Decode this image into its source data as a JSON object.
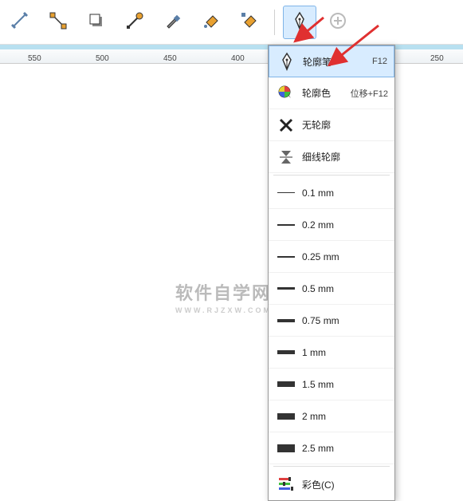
{
  "toolbar": {
    "tools": [
      {
        "name": "dimension-tool",
        "icon": "dimension"
      },
      {
        "name": "connector-tool",
        "icon": "connector"
      },
      {
        "name": "shadow-tool",
        "icon": "shadow"
      },
      {
        "name": "transparency-tool",
        "icon": "transparency"
      },
      {
        "name": "eyedropper-tool",
        "icon": "eyedropper"
      },
      {
        "name": "fill-tool",
        "icon": "fill"
      },
      {
        "name": "interactive-fill-tool",
        "icon": "interactive-fill"
      },
      {
        "name": "outline-pen-tool",
        "icon": "pen-nib",
        "active": true
      },
      {
        "name": "add-tool",
        "icon": "plus"
      }
    ]
  },
  "ruler": {
    "ticks": [
      {
        "pos": 35,
        "label": "550"
      },
      {
        "pos": 120,
        "label": "500"
      },
      {
        "pos": 205,
        "label": "450"
      },
      {
        "pos": 290,
        "label": "400"
      },
      {
        "pos": 540,
        "label": "250"
      }
    ]
  },
  "watermark": {
    "main": "软件自学网",
    "sub": "WWW.RJZXW.COM"
  },
  "flyout": {
    "items": [
      {
        "type": "cmd",
        "icon": "pen-nib",
        "label": "轮廓笔",
        "shortcut": "F12",
        "highlighted": true,
        "name": "outline-pen"
      },
      {
        "type": "cmd",
        "icon": "color-wheel",
        "label": "轮廓色",
        "shortcut": "位移+F12",
        "name": "outline-color"
      },
      {
        "type": "cmd",
        "icon": "x-mark",
        "label": "无轮廓",
        "name": "no-outline"
      },
      {
        "type": "cmd",
        "icon": "hairline",
        "label": "细线轮廓",
        "name": "hairline-outline"
      },
      {
        "type": "sep"
      },
      {
        "type": "thickness",
        "label": "0.1 mm",
        "h": 1,
        "name": "thickness-0-1"
      },
      {
        "type": "thickness",
        "label": "0.2 mm",
        "h": 2,
        "name": "thickness-0-2"
      },
      {
        "type": "thickness",
        "label": "0.25 mm",
        "h": 2,
        "name": "thickness-0-25"
      },
      {
        "type": "thickness",
        "label": "0.5 mm",
        "h": 3,
        "name": "thickness-0-5"
      },
      {
        "type": "thickness",
        "label": "0.75 mm",
        "h": 4,
        "name": "thickness-0-75"
      },
      {
        "type": "thickness",
        "label": "1 mm",
        "h": 5,
        "name": "thickness-1"
      },
      {
        "type": "thickness",
        "label": "1.5 mm",
        "h": 7,
        "name": "thickness-1-5"
      },
      {
        "type": "thickness",
        "label": "2 mm",
        "h": 8,
        "name": "thickness-2"
      },
      {
        "type": "thickness",
        "label": "2.5 mm",
        "h": 10,
        "name": "thickness-2-5"
      },
      {
        "type": "sep"
      },
      {
        "type": "cmd",
        "icon": "color-sliders",
        "label": "彩色(C)",
        "name": "color-more"
      }
    ]
  }
}
